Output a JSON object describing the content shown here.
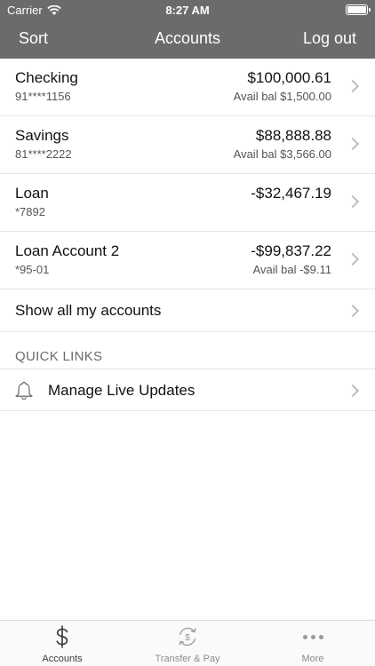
{
  "status_bar": {
    "carrier": "Carrier",
    "time": "8:27 AM"
  },
  "nav": {
    "sort_label": "Sort",
    "title": "Accounts",
    "logout_label": "Log out"
  },
  "accounts": [
    {
      "name": "Checking",
      "number": "91****1156",
      "amount": "$100,000.61",
      "available": "Avail bal $1,500.00"
    },
    {
      "name": "Savings",
      "number": "81****2222",
      "amount": "$88,888.88",
      "available": "Avail bal $3,566.00"
    },
    {
      "name": "Loan",
      "number": "*7892",
      "amount": "-$32,467.19",
      "available": ""
    },
    {
      "name": "Loan Account 2",
      "number": "*95-01",
      "amount": "-$99,837.22",
      "available": "Avail bal -$9.11"
    }
  ],
  "show_all_label": "Show all my accounts",
  "quick_links": {
    "header": "QUICK LINKS",
    "items": [
      {
        "label": "Manage Live Updates",
        "icon": "bell-icon"
      }
    ]
  },
  "tab_bar": {
    "tabs": [
      {
        "label": "Accounts",
        "icon": "dollar-icon",
        "active": true
      },
      {
        "label": "Transfer & Pay",
        "icon": "transfer-icon",
        "active": false
      },
      {
        "label": "More",
        "icon": "more-icon",
        "active": false
      }
    ]
  },
  "colors": {
    "header_bg": "#6b6b6b",
    "header_text": "#ffffff",
    "divider": "#e4e4e4",
    "secondary_text": "#555555"
  }
}
